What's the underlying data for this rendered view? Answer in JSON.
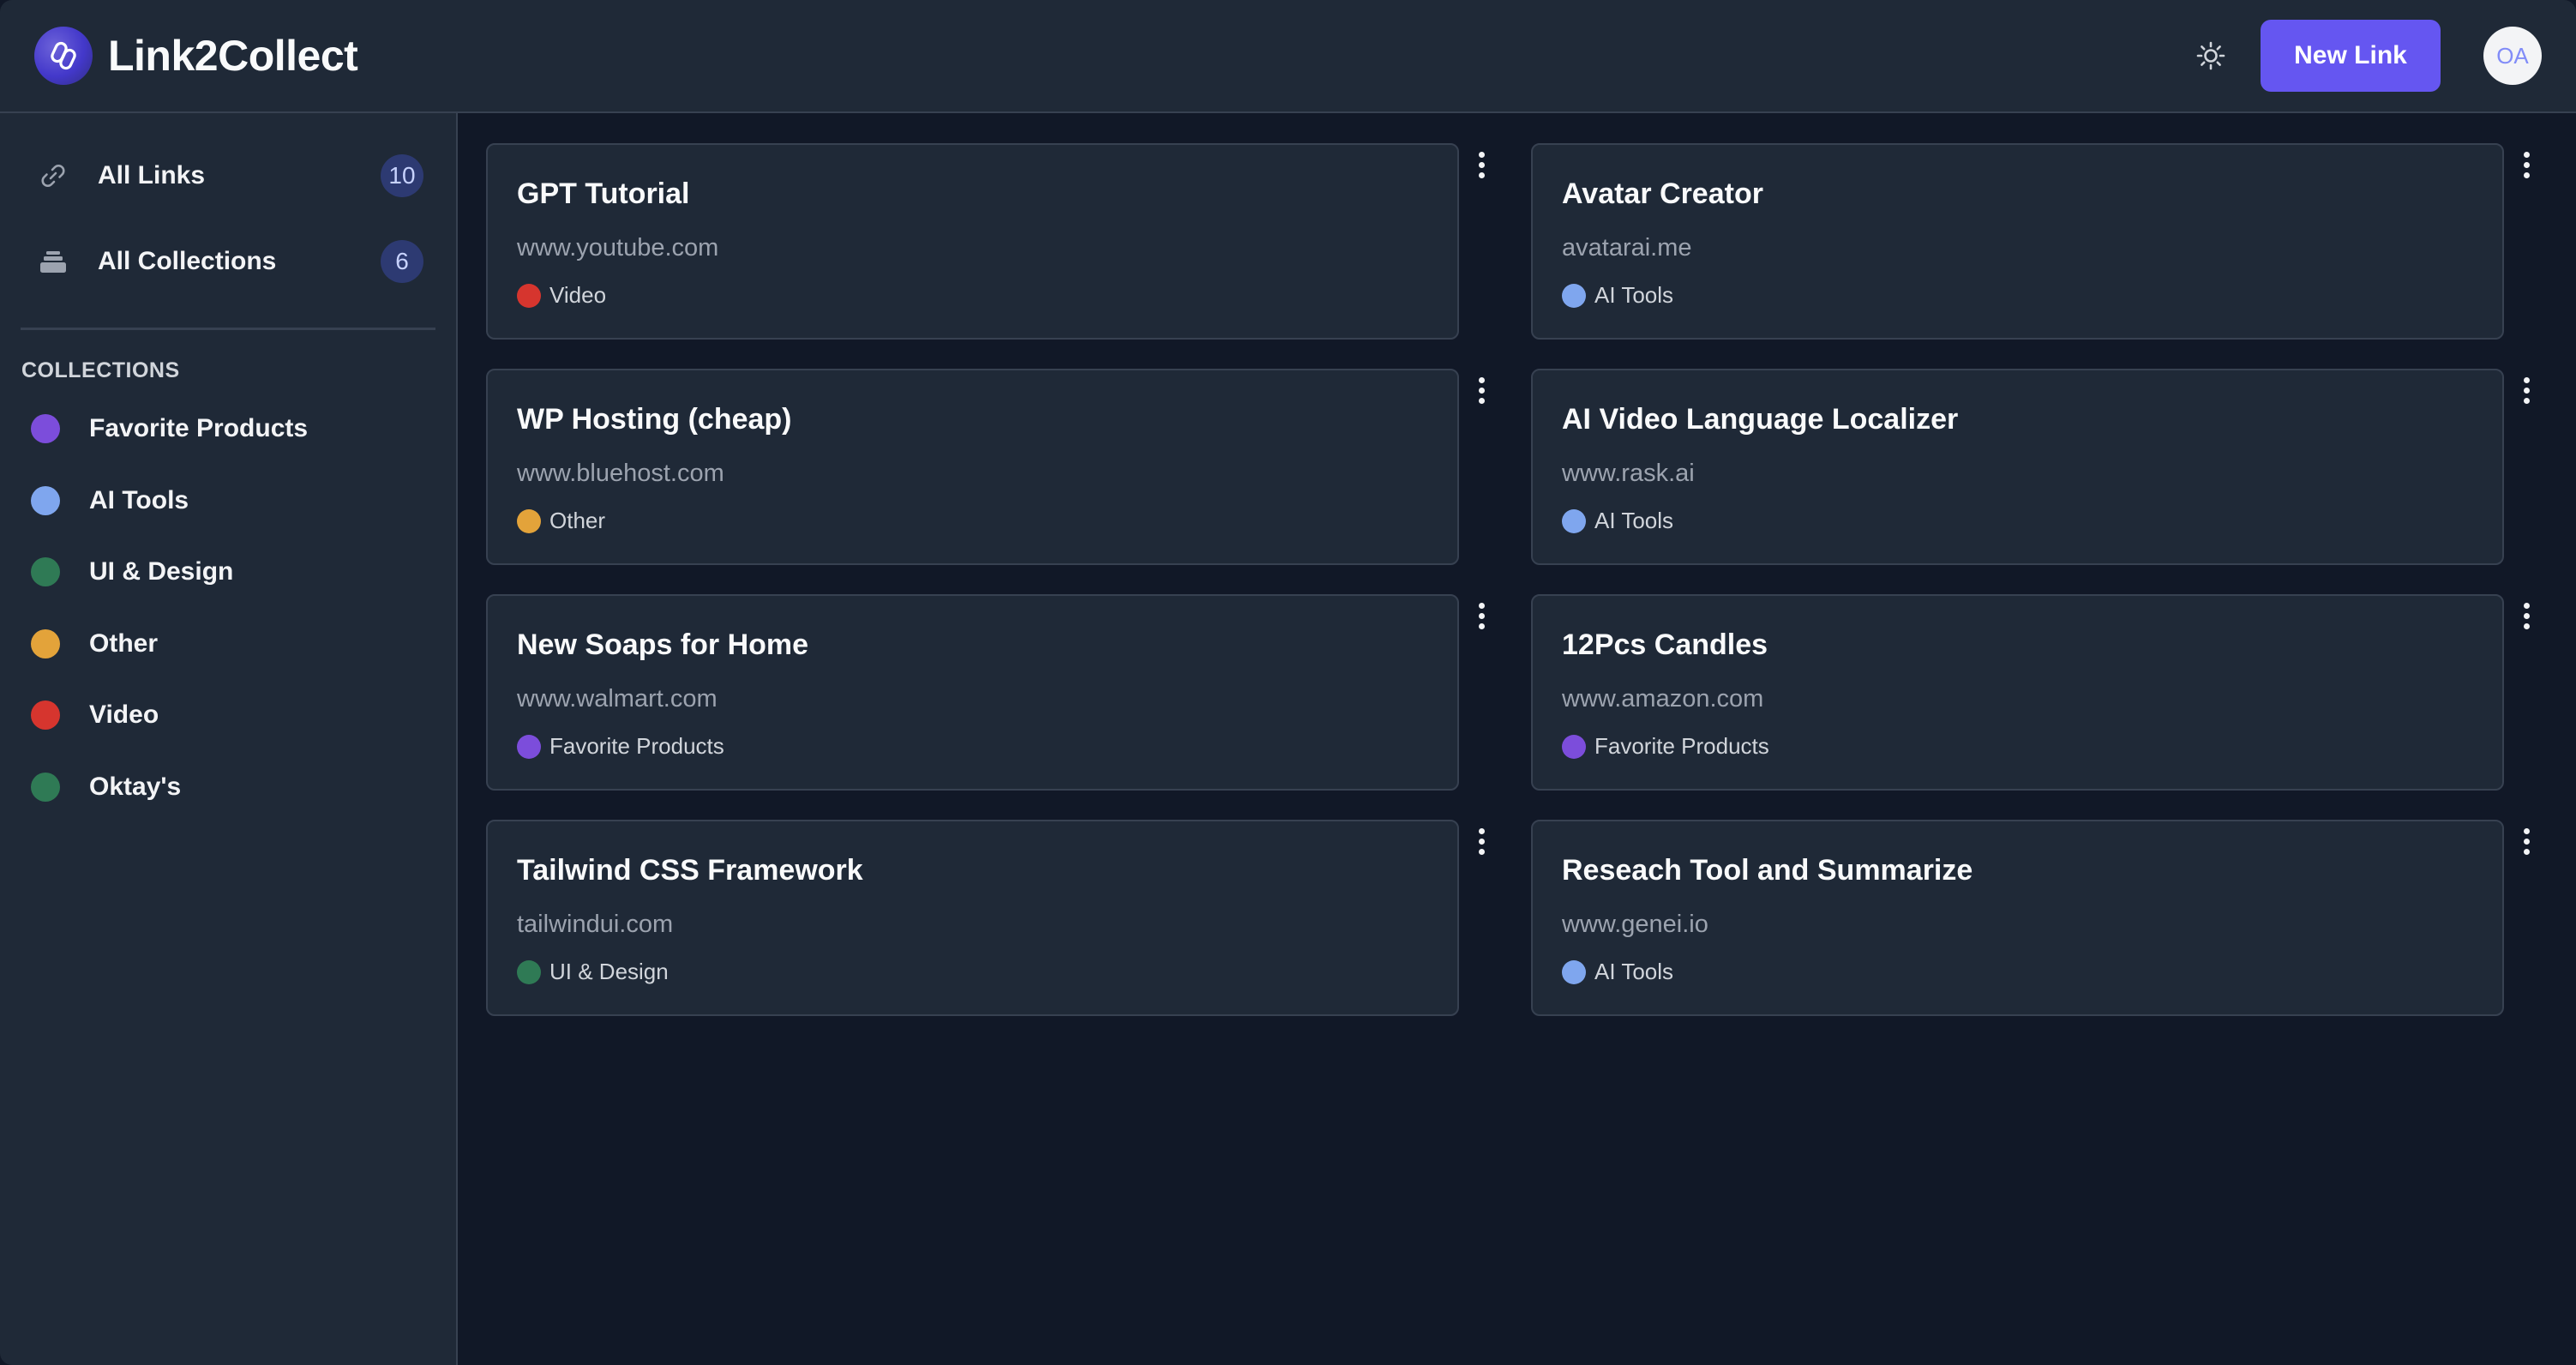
{
  "header": {
    "title": "Link2Collect",
    "logo_icon": "link-logo-icon",
    "theme_icon": "sun-icon",
    "new_link_label": "New Link",
    "avatar_initials": "OA",
    "accent_color": "#6556f1"
  },
  "sidebar": {
    "nav": [
      {
        "label": "All Links",
        "count": "10",
        "icon": "link-icon"
      },
      {
        "label": "All Collections",
        "count": "6",
        "icon": "stack-icon"
      }
    ],
    "section_heading": "COLLECTIONS",
    "collections": [
      {
        "label": "Favorite Products",
        "color": "#7c4ddb"
      },
      {
        "label": "AI Tools",
        "color": "#7fa6ee"
      },
      {
        "label": "UI & Design",
        "color": "#2f7a55"
      },
      {
        "label": "Other",
        "color": "#e3a33a"
      },
      {
        "label": "Video",
        "color": "#d6352e"
      },
      {
        "label": "Oktay's",
        "color": "#2f7a55"
      }
    ]
  },
  "links": [
    {
      "title": "GPT Tutorial",
      "url": "www.youtube.com",
      "collection": "Video",
      "color": "#d6352e"
    },
    {
      "title": "Avatar Creator",
      "url": "avatarai.me",
      "collection": "AI Tools",
      "color": "#7fa6ee"
    },
    {
      "title": "WP Hosting (cheap)",
      "url": "www.bluehost.com",
      "collection": "Other",
      "color": "#e3a33a"
    },
    {
      "title": "AI Video Language Localizer",
      "url": "www.rask.ai",
      "collection": "AI Tools",
      "color": "#7fa6ee"
    },
    {
      "title": "New Soaps for Home",
      "url": "www.walmart.com",
      "collection": "Favorite Products",
      "color": "#7c4ddb"
    },
    {
      "title": "12Pcs Candles",
      "url": "www.amazon.com",
      "collection": "Favorite Products",
      "color": "#7c4ddb"
    },
    {
      "title": "Tailwind CSS Framework",
      "url": "tailwindui.com",
      "collection": "UI & Design",
      "color": "#2f7a55"
    },
    {
      "title": "Reseach Tool and Summarize",
      "url": "www.genei.io",
      "collection": "AI Tools",
      "color": "#7fa6ee"
    }
  ]
}
